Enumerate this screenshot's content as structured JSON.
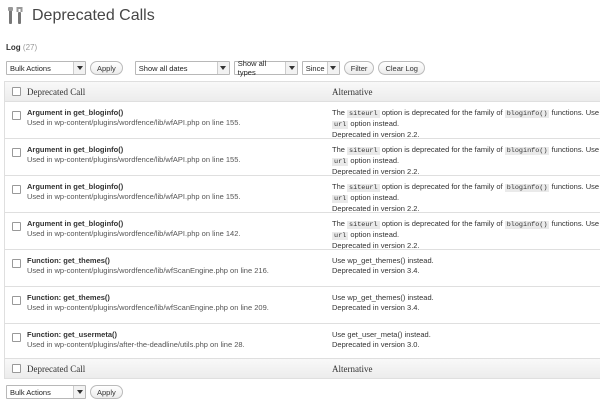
{
  "page": {
    "title": "Deprecated Calls",
    "title_icon": "tools-icon"
  },
  "log": {
    "label": "Log",
    "count": "(27)"
  },
  "toolbar_top": {
    "bulk_actions": "Bulk Actions",
    "apply": "Apply",
    "dates": "Show all dates",
    "types": "Show all types",
    "since": "Since",
    "filter": "Filter",
    "clear_log": "Clear Log"
  },
  "toolbar_bottom": {
    "bulk_actions": "Bulk Actions",
    "apply": "Apply"
  },
  "table": {
    "header": {
      "call": "Deprecated Call",
      "alt": "Alternative"
    },
    "footer": {
      "call": "Deprecated Call",
      "alt": "Alternative"
    },
    "rows": [
      {
        "name": "Argument in get_bloginfo()",
        "used": "Used in wp-content/plugins/wordfence/lib/wfAPI.php on line 155.",
        "alt1_pre": "The",
        "alt1_code1": "siteurl",
        "alt1_mid": "option is deprecated for the family of",
        "alt1_code2": "bloginfo()",
        "alt1_post": "functions. Use",
        "alt2_code": "url",
        "alt2_post": "option instead.",
        "version": "Deprecated in version 2.2."
      },
      {
        "name": "Argument in get_bloginfo()",
        "used": "Used in wp-content/plugins/wordfence/lib/wfAPI.php on line 155.",
        "alt1_pre": "The",
        "alt1_code1": "siteurl",
        "alt1_mid": "option is deprecated for the family of",
        "alt1_code2": "bloginfo()",
        "alt1_post": "functions. Use",
        "alt2_code": "url",
        "alt2_post": "option instead.",
        "version": "Deprecated in version 2.2."
      },
      {
        "name": "Argument in get_bloginfo()",
        "used": "Used in wp-content/plugins/wordfence/lib/wfAPI.php on line 155.",
        "alt1_pre": "The",
        "alt1_code1": "siteurl",
        "alt1_mid": "option is deprecated for the family of",
        "alt1_code2": "bloginfo()",
        "alt1_post": "functions. Use",
        "alt2_code": "url",
        "alt2_post": "option instead.",
        "version": "Deprecated in version 2.2."
      },
      {
        "name": "Argument in get_bloginfo()",
        "used": "Used in wp-content/plugins/wordfence/lib/wfAPI.php on line 142.",
        "alt1_pre": "The",
        "alt1_code1": "siteurl",
        "alt1_mid": "option is deprecated for the family of",
        "alt1_code2": "bloginfo()",
        "alt1_post": "functions. Use",
        "alt2_code": "url",
        "alt2_post": "option instead.",
        "version": "Deprecated in version 2.2."
      },
      {
        "name": "Function: get_themes()",
        "used": "Used in wp-content/plugins/wordfence/lib/wfScanEngine.php on line 216.",
        "alt_simple": "Use wp_get_themes() instead.",
        "version": "Deprecated in version 3.4."
      },
      {
        "name": "Function: get_themes()",
        "used": "Used in wp-content/plugins/wordfence/lib/wfScanEngine.php on line 209.",
        "alt_simple": "Use wp_get_themes() instead.",
        "version": "Deprecated in version 3.4."
      },
      {
        "name": "Function: get_usermeta()",
        "used": "Used in wp-content/plugins/after-the-deadline/utils.php on line 28.",
        "alt_simple": "Use get_user_meta() instead.",
        "version": "Deprecated in version 3.0."
      }
    ]
  }
}
